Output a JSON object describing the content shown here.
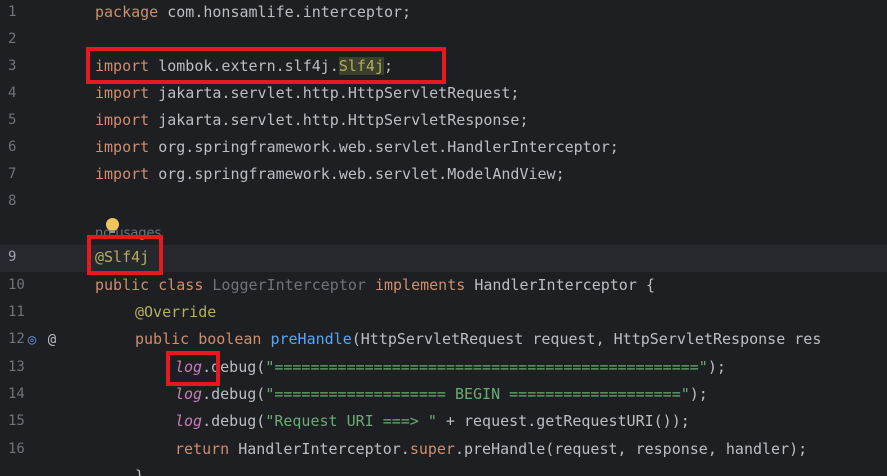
{
  "editor": {
    "lines": [
      {
        "num": "1",
        "package_kw": "package",
        "package_name": " com.honsamlife.interceptor;"
      },
      {
        "num": "2"
      },
      {
        "num": "3",
        "import_kw": "import",
        "path": " lombok.extern.slf4j.",
        "cls": "Slf4j",
        "semi": ";"
      },
      {
        "num": "4",
        "import_kw": "import",
        "path": " jakarta.servlet.http.HttpServletRequest;"
      },
      {
        "num": "5",
        "import_kw": "import",
        "path": " jakarta.servlet.http.HttpServletResponse;"
      },
      {
        "num": "6",
        "import_kw": "import",
        "path": " org.springframework.web.servlet.HandlerInterceptor;"
      },
      {
        "num": "7",
        "import_kw": "import",
        "path": " org.springframework.web.servlet.ModelAndView;"
      },
      {
        "num": "8"
      },
      {
        "num": "9",
        "annotation": "@Slf4j"
      },
      {
        "num": "10",
        "public_kw": "public",
        "class_kw": " class ",
        "class_name": "LoggerInterceptor",
        "implements_kw": " implements ",
        "iface": "HandlerInterceptor {"
      },
      {
        "num": "11",
        "annotation": "@Override"
      },
      {
        "num": "12",
        "public_kw": "public",
        "boolean_kw": " boolean ",
        "method": "preHandle",
        "params": "(HttpServletRequest request, HttpServletResponse res"
      },
      {
        "num": "13",
        "log": "log",
        "call": ".debug(",
        "str": "\"===============================================\"",
        "end": ");"
      },
      {
        "num": "14",
        "log": "log",
        "call": ".debug(",
        "str": "\"=================== BEGIN ===================\"",
        "end": ");"
      },
      {
        "num": "15",
        "log": "log",
        "call": ".debug(",
        "str": "\"Request URI ===> \"",
        "end": " + request.getRequestURI());"
      },
      {
        "num": "16",
        "return_kw": "return",
        "pre": " HandlerInterceptor.",
        "super_kw": "super",
        "post": ".preHandle(request, response, handler);"
      }
    ],
    "usage_hint": "no usages",
    "partial_line_text": "}"
  },
  "colors": {
    "background": "#1e1f22",
    "highlight_box": "#e5191e",
    "keyword": "#cf8e6d",
    "annotation": "#b3ae60",
    "string": "#6aab73"
  },
  "icons": {
    "bulb": "lightbulb-icon",
    "override": "override-gutter-icon",
    "annotation_marker": "at-gutter-icon"
  }
}
